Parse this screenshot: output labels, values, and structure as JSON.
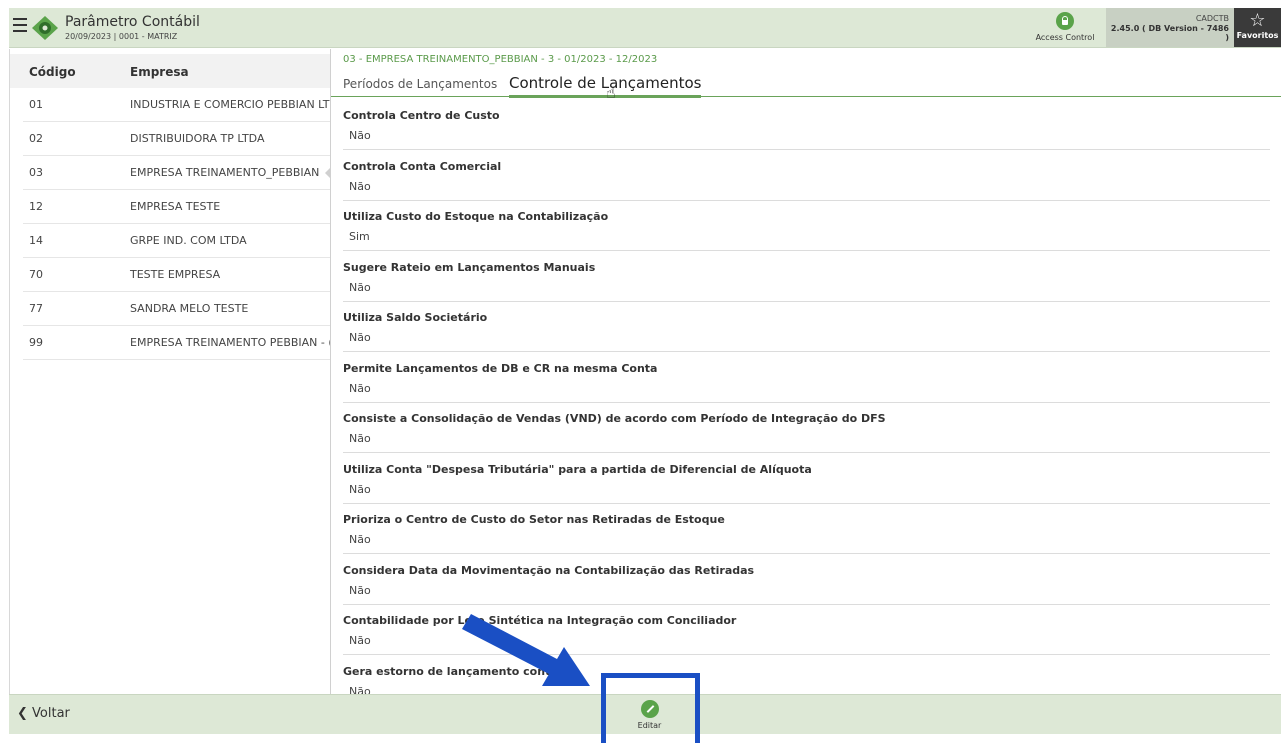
{
  "header": {
    "title": "Parâmetro Contábil",
    "subtitle": "20/09/2023 | 0001 - MATRIZ",
    "access_label": "Access Control",
    "program_code": "CADCTB",
    "version": "2.45.0 ( DB Version - 7486 )",
    "favorites_label": "Favoritos"
  },
  "grid": {
    "headers": [
      "Código",
      "Empresa"
    ],
    "rows": [
      {
        "code": "01",
        "name": "INDUSTRIA E COMERCIO PEBBIAN LT"
      },
      {
        "code": "02",
        "name": "DISTRIBUIDORA TP LTDA"
      },
      {
        "code": "03",
        "name": "EMPRESA TREINAMENTO_PEBBIAN"
      },
      {
        "code": "12",
        "name": "EMPRESA TESTE"
      },
      {
        "code": "14",
        "name": "GRPE IND. COM LTDA"
      },
      {
        "code": "70",
        "name": "TESTE EMPRESA"
      },
      {
        "code": "77",
        "name": "SANDRA MELO TESTE"
      },
      {
        "code": "99",
        "name": "EMPRESA TREINAMENTO PEBBIAN - ("
      }
    ],
    "selected_index": 2
  },
  "detail": {
    "context": "03 - EMPRESA TREINAMENTO_PEBBIAN - 3 - 01/2023 - 12/2023",
    "tabs": [
      "Períodos de Lançamentos",
      "Controle de Lançamentos"
    ],
    "active_tab": 1,
    "fields": [
      {
        "label": "Controla Centro de Custo",
        "value": "Não"
      },
      {
        "label": "Controla Conta Comercial",
        "value": "Não"
      },
      {
        "label": "Utiliza Custo do Estoque na Contabilização",
        "value": "Sim"
      },
      {
        "label": "Sugere Rateio em Lançamentos Manuais",
        "value": "Não"
      },
      {
        "label": "Utiliza Saldo Societário",
        "value": "Não"
      },
      {
        "label": "Permite Lançamentos de DB e CR na mesma Conta",
        "value": "Não"
      },
      {
        "label": "Consiste a Consolidação de Vendas (VND) de acordo com Período de Integração do DFS",
        "value": "Não"
      },
      {
        "label": "Utiliza Conta \"Despesa Tributária\" para a partida de Diferencial de Alíquota",
        "value": "Não"
      },
      {
        "label": "Prioriza o Centro de Custo do Setor nas Retiradas de Estoque",
        "value": "Não"
      },
      {
        "label": "Considera Data da Movimentação na Contabilização das Retiradas",
        "value": "Não"
      },
      {
        "label": "Contabilidade por Lote Sintética na Integração com Conciliador",
        "value": "Não"
      },
      {
        "label": "Gera estorno de lançamento contábil",
        "value": "Não"
      }
    ]
  },
  "footer": {
    "back_label": "Voltar",
    "edit_label": "Editar"
  },
  "colors": {
    "accent": "#6aa35a",
    "header_bg": "#dde8d6",
    "annotation": "#1a4fc4"
  }
}
